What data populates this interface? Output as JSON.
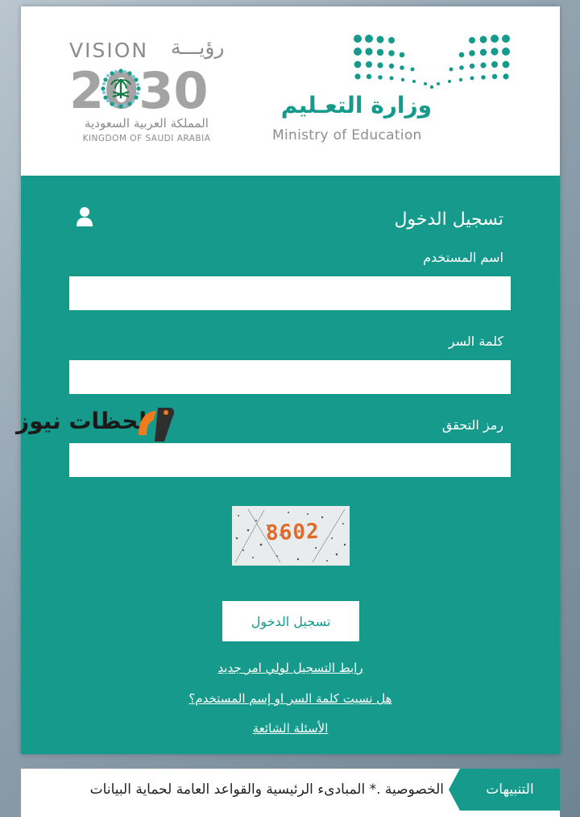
{
  "header": {
    "vision_logo": {
      "word": "VISION",
      "arabic_word": "رؤيـــة",
      "year": "2030",
      "kingdom_ar": "المملكة العربية السعودية",
      "kingdom_en": "KINGDOM OF SAUDI ARABIA"
    },
    "ministry_logo": {
      "arabic": "وزارة التعـليم",
      "english": "Ministry of Education"
    }
  },
  "login": {
    "title": "تسجيل الدخول",
    "username_label": "اسم المستخدم",
    "username_value": "",
    "password_label": "كلمة السر",
    "password_value": "",
    "captcha_label": "رمز التحقق",
    "captcha_value": "",
    "captcha_code": "8602",
    "submit_label": "تسجيل الدخول"
  },
  "links": {
    "register_guardian": "رابط التسجيل لولي امر جديد",
    "forgot": "هل نسيت كلمة السر او إسم المستخدم؟",
    "faq": "الأسئلة الشائعة"
  },
  "watermark": {
    "text": "لحظات نيوز"
  },
  "ticker": {
    "label": "التنبيهات",
    "text": "الخصوصية .* المبادىء الرئيسية والقواعد العامة لحماية البيانات"
  },
  "colors": {
    "brand": "#159a8c",
    "logo_gray": "#8b8b8b",
    "white": "#ffffff"
  }
}
